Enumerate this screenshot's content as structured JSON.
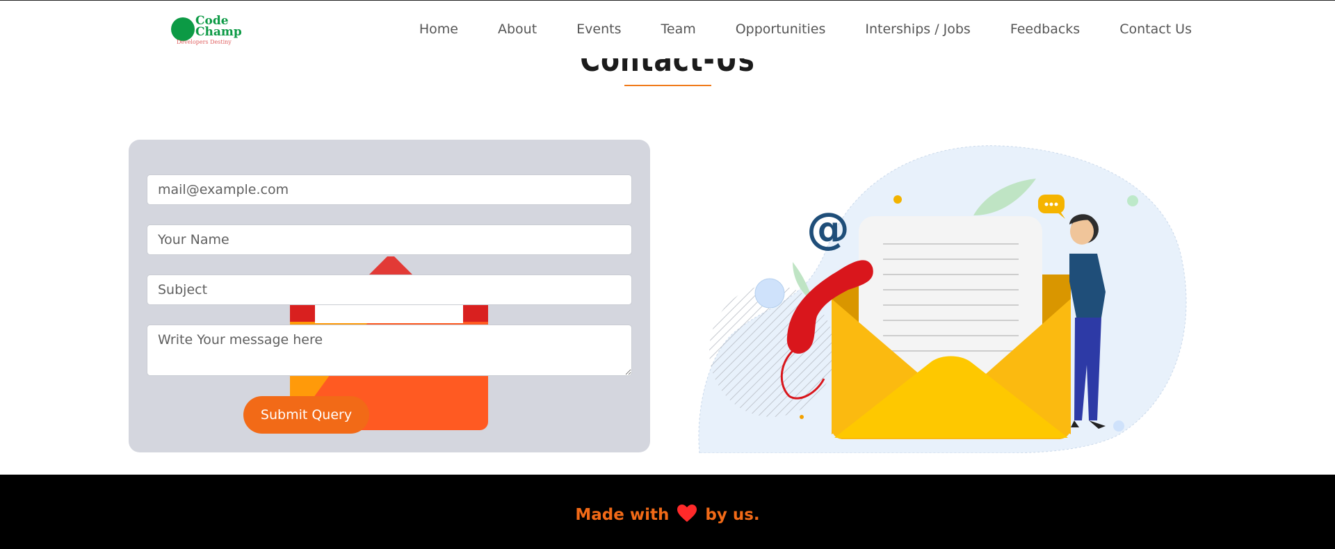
{
  "brand": {
    "line1": "Code",
    "line2": "Champ",
    "tagline": "Developers Destiny",
    "color": "#0c9a45"
  },
  "nav": {
    "items": [
      {
        "label": "Home"
      },
      {
        "label": "About"
      },
      {
        "label": "Events"
      },
      {
        "label": "Team"
      },
      {
        "label": "Opportunities"
      },
      {
        "label": "Interships / Jobs"
      },
      {
        "label": "Feedbacks"
      },
      {
        "label": "Contact Us"
      }
    ]
  },
  "section": {
    "title": "Contact-Us"
  },
  "form": {
    "email_placeholder": "mail@example.com",
    "name_placeholder": "Your Name",
    "subject_placeholder": "Subject",
    "message_placeholder": "Write Your message here",
    "submit_label": "Submit Query",
    "accent": "#f26a17"
  },
  "illustration": {
    "at_symbol": "@",
    "icons": [
      "envelope-icon",
      "phone-receiver-icon",
      "at-sign-icon",
      "chat-bubble-icon",
      "support-agent"
    ]
  },
  "footer": {
    "before": "Made with",
    "after": "by us."
  }
}
